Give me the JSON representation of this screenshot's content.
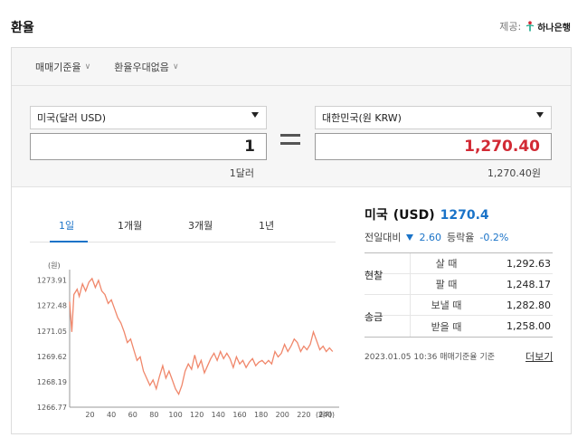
{
  "header": {
    "title": "환율",
    "provider_label": "제공:",
    "provider_name": "하나은행"
  },
  "topbar": {
    "option1": "매매기준율",
    "option2": "환율우대없음"
  },
  "converter": {
    "from_currency": "미국(달러 USD)",
    "to_currency": "대한민국(원 KRW)",
    "from_amount": "1",
    "to_amount": "1,270.40",
    "from_unit_text": "1달러",
    "to_unit_text": "1,270.40원"
  },
  "tabs": [
    "1일",
    "1개월",
    "3개월",
    "1년"
  ],
  "quote": {
    "country": "미국",
    "code": "(USD)",
    "rate": "1270.4",
    "change_label": "전일대비",
    "change_value": "2.60",
    "change_pct_label": "등락율",
    "change_pct": "-0.2%"
  },
  "rates": {
    "cash_label": "현찰",
    "remit_label": "송금",
    "rows": [
      {
        "label": "살 때",
        "value": "1,292.63"
      },
      {
        "label": "팔 때",
        "value": "1,248.17"
      },
      {
        "label": "보낼 때",
        "value": "1,282.80"
      },
      {
        "label": "받을 때",
        "value": "1,258.00"
      }
    ]
  },
  "footnote": "2023.01.05 10:36  매매기준율 기준",
  "more_link": "더보기",
  "colors": {
    "accent": "#1a73c8",
    "down": "#1a73c8",
    "krw_amount": "#d22a35",
    "line": "#f0876b"
  },
  "chart_data": {
    "type": "line",
    "title": "",
    "xlabel": "(회차)",
    "ylabel": "(원)",
    "yticks": [
      "1273.91",
      "1272.48",
      "1271.05",
      "1269.62",
      "1268.19",
      "1266.77"
    ],
    "ytick_values": [
      1273.91,
      1272.48,
      1271.05,
      1269.62,
      1268.19,
      1266.77
    ],
    "xticks": [
      20,
      40,
      60,
      80,
      100,
      120,
      140,
      160,
      180,
      200,
      220,
      240
    ],
    "xlim": [
      1,
      248
    ],
    "ylim": [
      1266.77,
      1274.5
    ],
    "grid": false,
    "series": [
      {
        "x": [
          1,
          3,
          5,
          8,
          10,
          13,
          16,
          19,
          22,
          25,
          28,
          31,
          34,
          37,
          40,
          43,
          46,
          49,
          52,
          55,
          58,
          61,
          64,
          67,
          70,
          73,
          76,
          79,
          82,
          85,
          88,
          91,
          94,
          97,
          100,
          103,
          106,
          109,
          112,
          115,
          118,
          121,
          124,
          127,
          130,
          133,
          136,
          139,
          142,
          145,
          148,
          151,
          154,
          157,
          160,
          163,
          166,
          169,
          172,
          175,
          178,
          181,
          184,
          187,
          190,
          193,
          196,
          199,
          202,
          205,
          208,
          211,
          214,
          217,
          220,
          223,
          226,
          229,
          232,
          235,
          238,
          241,
          244,
          247
        ],
        "y": [
          1272.7,
          1271.0,
          1273.1,
          1273.4,
          1273.0,
          1273.7,
          1273.3,
          1273.8,
          1274.0,
          1273.5,
          1273.9,
          1273.3,
          1273.1,
          1272.6,
          1272.8,
          1272.3,
          1271.8,
          1271.5,
          1271.0,
          1270.4,
          1270.6,
          1270.0,
          1269.4,
          1269.6,
          1268.8,
          1268.4,
          1268.0,
          1268.3,
          1267.8,
          1268.5,
          1269.1,
          1268.4,
          1268.8,
          1268.3,
          1267.8,
          1267.5,
          1268.0,
          1268.8,
          1269.2,
          1268.9,
          1269.7,
          1269.0,
          1269.4,
          1268.7,
          1269.1,
          1269.5,
          1269.8,
          1269.4,
          1269.9,
          1269.5,
          1269.8,
          1269.5,
          1269.0,
          1269.6,
          1269.2,
          1269.4,
          1269.0,
          1269.3,
          1269.5,
          1269.1,
          1269.3,
          1269.4,
          1269.2,
          1269.4,
          1269.2,
          1269.9,
          1269.6,
          1269.8,
          1270.3,
          1269.9,
          1270.2,
          1270.6,
          1270.4,
          1269.9,
          1270.2,
          1270.0,
          1270.3,
          1271.0,
          1270.5,
          1270.0,
          1270.2,
          1269.9,
          1270.1,
          1269.9
        ]
      }
    ]
  }
}
